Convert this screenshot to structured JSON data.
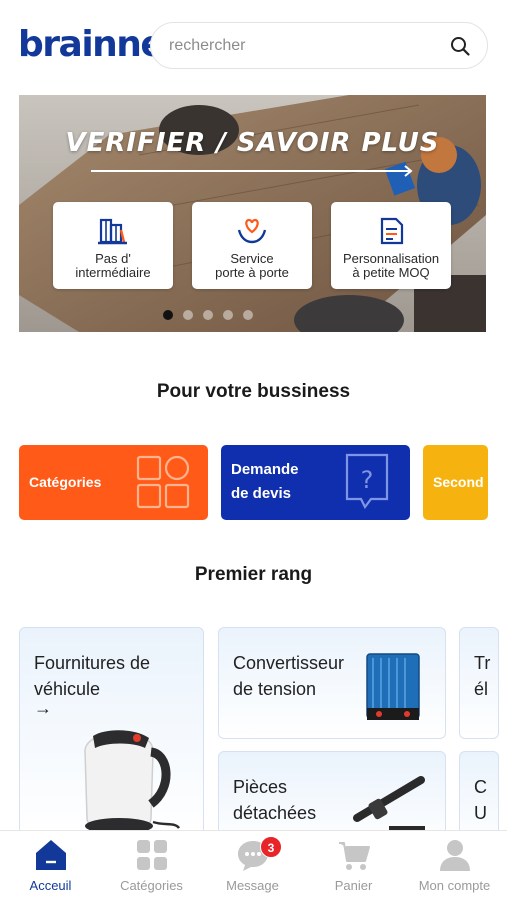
{
  "header": {
    "logo": "brainnel",
    "search_placeholder": "rechercher"
  },
  "banner": {
    "title": "VERIFIER / SAVOIR PLUS",
    "features": [
      {
        "label": "Pas d'\nintermédiaire",
        "icon": "buildings-icon"
      },
      {
        "label": "Service\nporte à porte",
        "icon": "heart-hands-icon"
      },
      {
        "label": "Personnalisation\nà petite MOQ",
        "icon": "document-icon"
      }
    ],
    "slide_count": 5,
    "active_slide": 1
  },
  "business": {
    "title": "Pour votre bussiness",
    "tiles": [
      {
        "label": "Catégories",
        "color": "#ff5a17"
      },
      {
        "label": "Demande\nde devis",
        "color": "#0f2fae"
      },
      {
        "label": "Second",
        "color": "#f6b30f"
      }
    ]
  },
  "premier": {
    "title": "Premier rang",
    "cards": [
      {
        "label": "Fournitures de\nvéhicule",
        "arrow": "→"
      },
      {
        "label": "Convertisseur\nde tension"
      },
      {
        "label": "Tr\nél"
      },
      {
        "label": "Pièces\ndétachées"
      },
      {
        "label": "C\nU"
      }
    ]
  },
  "tabbar": {
    "tabs": [
      {
        "label": "Acceuil",
        "icon": "home-icon",
        "active": true
      },
      {
        "label": "Catégories",
        "icon": "grid-icon",
        "active": false
      },
      {
        "label": "Message",
        "icon": "chat-icon",
        "active": false,
        "badge": "3"
      },
      {
        "label": "Panier",
        "icon": "cart-icon",
        "active": false
      },
      {
        "label": "Mon compte",
        "icon": "user-icon",
        "active": false
      }
    ]
  },
  "colors": {
    "brand": "#12399a",
    "orange": "#ff5a17",
    "blue": "#0f2fae",
    "yellow": "#f6b30f",
    "badge": "#e8262a"
  }
}
